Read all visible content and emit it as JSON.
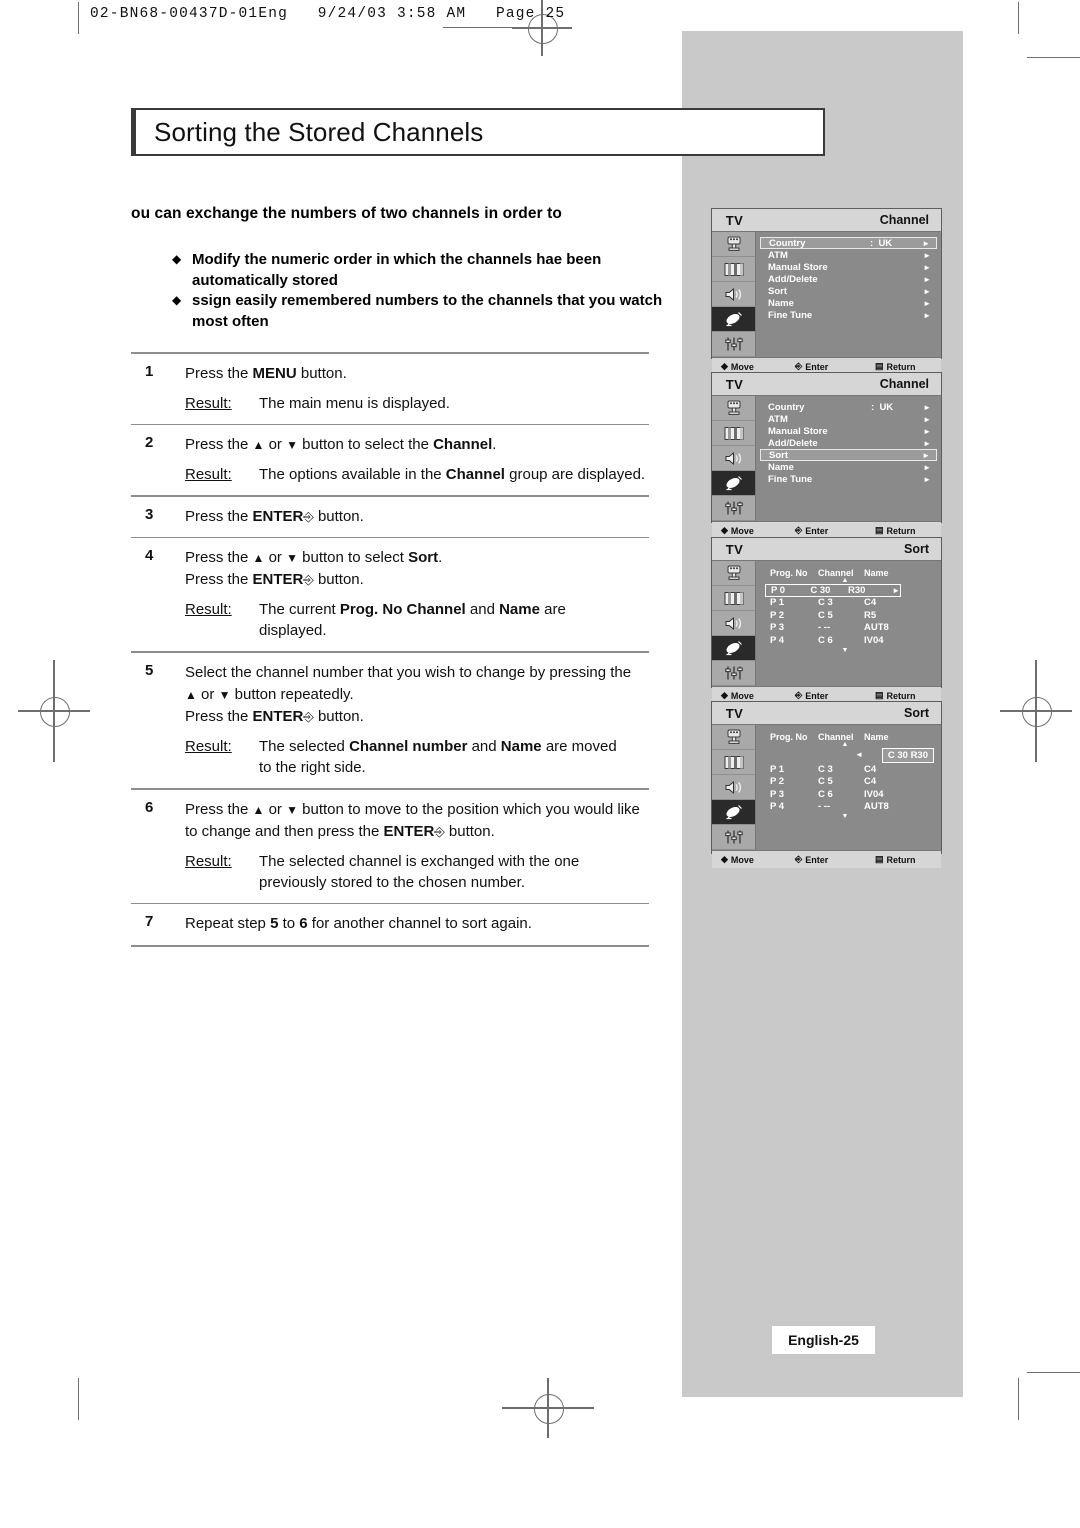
{
  "print_header": {
    "text": "02-BN68-00437D-01Eng   9/24/03 3:58 AM   Page 25"
  },
  "title": "Sorting the Stored Channels",
  "intro": {
    "lead": "ou can exchange the numbers of two channels in order to",
    "bullets": [
      "Modify the numeric order in which the channels hae been automatically stored",
      "ssign easily remembered numbers to the channels that you watch most often"
    ],
    "bullet_glyph": "♦"
  },
  "steps": [
    {
      "num": "1",
      "lines": [
        "Press the MENU button."
      ],
      "result_label": "Result:",
      "result": "The main menu is displayed."
    },
    {
      "num": "2",
      "lines": [
        "Press the ▲ or ▼ button to select the Channel."
      ],
      "result_label": "Result:",
      "result": "The options available in the Channel group are displayed."
    },
    {
      "num": "3",
      "lines": [
        "Press the ENTER button."
      ],
      "result_label": "",
      "result": ""
    },
    {
      "num": "4",
      "lines": [
        "Press the ▲ or ▼ button to select Sort.",
        "Press the ENTER button."
      ],
      "result_label": "Result:",
      "result": "The current Prog. No Channel  and Name are displayed."
    },
    {
      "num": "5",
      "lines": [
        "Select the channel number that you wish to change by pressing the ▲ or ▼ button repeatedly.",
        "Press the ENTER button."
      ],
      "result_label": "Result:",
      "result": "The selected Channel number and Name are moved to the right side."
    },
    {
      "num": "6",
      "lines": [
        "Press the ▲ or ▼ button to move to the position which you would like to change and then press the ENTER button."
      ],
      "result_label": "Result:",
      "result": "The selected channel is exchanged with the one previously stored to the chosen number."
    },
    {
      "num": "7",
      "lines": [
        "Repeat step 5 to 6 for another channel to sort again."
      ],
      "result_label": "",
      "result": ""
    }
  ],
  "osd": {
    "source_label": "TV",
    "footer": {
      "move": "Move",
      "enter": "Enter",
      "return": "Return"
    },
    "rail_icons": [
      "input-source-icon",
      "picture-icon",
      "sound-icon",
      "channel-dish-icon",
      "setup-sliders-icon"
    ],
    "screens": [
      {
        "title": "Channel",
        "type": "menu",
        "highlight": "Country",
        "items": [
          {
            "name": "Country",
            "sep": ":",
            "value": "UK"
          },
          {
            "name": "ATM",
            "sep": "",
            "value": ""
          },
          {
            "name": "Manual Store",
            "sep": "",
            "value": ""
          },
          {
            "name": "Add/Delete",
            "sep": "",
            "value": ""
          },
          {
            "name": "Sort",
            "sep": "",
            "value": ""
          },
          {
            "name": "Name",
            "sep": "",
            "value": ""
          },
          {
            "name": "Fine Tune",
            "sep": "",
            "value": ""
          }
        ]
      },
      {
        "title": "Channel",
        "type": "menu",
        "highlight": "Sort",
        "items": [
          {
            "name": "Country",
            "sep": ":",
            "value": "UK"
          },
          {
            "name": "ATM",
            "sep": "",
            "value": ""
          },
          {
            "name": "Manual Store",
            "sep": "",
            "value": ""
          },
          {
            "name": "Add/Delete",
            "sep": "",
            "value": ""
          },
          {
            "name": "Sort",
            "sep": "",
            "value": ""
          },
          {
            "name": "Name",
            "sep": "",
            "value": ""
          },
          {
            "name": "Fine Tune",
            "sep": "",
            "value": ""
          }
        ]
      },
      {
        "title": "Sort",
        "type": "sort",
        "headers": [
          "Prog. No",
          "Channel",
          "Name"
        ],
        "rows": [
          {
            "prog": "P  0",
            "channel": "C 30",
            "name": "R30",
            "highlight": true
          },
          {
            "prog": "P  1",
            "channel": "C  3",
            "name": "C4",
            "highlight": false
          },
          {
            "prog": "P  2",
            "channel": "C  5",
            "name": "R5",
            "highlight": false
          },
          {
            "prog": "P  3",
            "channel": "-  --",
            "name": "AUT8",
            "highlight": false
          },
          {
            "prog": "P  4",
            "channel": "C  6",
            "name": "IV04",
            "highlight": false
          }
        ],
        "moved_value": ""
      },
      {
        "title": "Sort",
        "type": "sort",
        "headers": [
          "Prog. No",
          "Channel",
          "Name"
        ],
        "rows": [
          {
            "prog": "P  1",
            "channel": "C  3",
            "name": "C4",
            "highlight": false
          },
          {
            "prog": "P  2",
            "channel": "C  5",
            "name": "C4",
            "highlight": false
          },
          {
            "prog": "P  3",
            "channel": "C  6",
            "name": "IV04",
            "highlight": false
          },
          {
            "prog": "P  4",
            "channel": "-  --",
            "name": "AUT8",
            "highlight": false
          }
        ],
        "moved_value": "C 30  R30"
      }
    ]
  },
  "page_footer": "English-25"
}
